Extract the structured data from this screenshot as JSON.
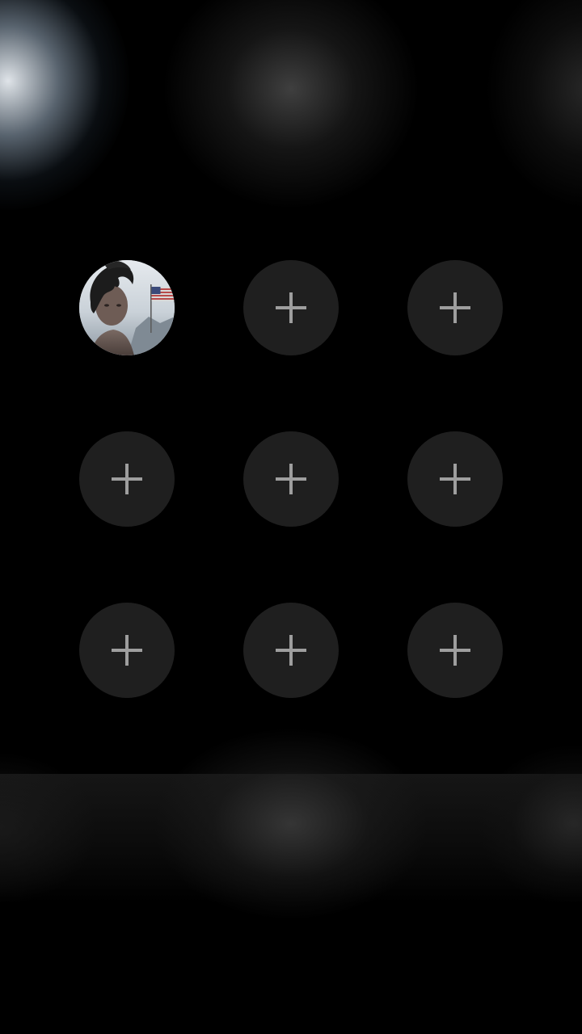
{
  "screen": {
    "background_color": "#000000",
    "slot_color": "#1f1f1f",
    "plus_color": "#9e9e9e"
  },
  "grid": {
    "rows": 3,
    "columns": 3,
    "slots": [
      {
        "type": "avatar",
        "icon": "profile-photo"
      },
      {
        "type": "add",
        "icon": "plus-icon"
      },
      {
        "type": "add",
        "icon": "plus-icon"
      },
      {
        "type": "add",
        "icon": "plus-icon"
      },
      {
        "type": "add",
        "icon": "plus-icon"
      },
      {
        "type": "add",
        "icon": "plus-icon"
      },
      {
        "type": "add",
        "icon": "plus-icon"
      },
      {
        "type": "add",
        "icon": "plus-icon"
      },
      {
        "type": "add",
        "icon": "plus-icon"
      }
    ]
  }
}
